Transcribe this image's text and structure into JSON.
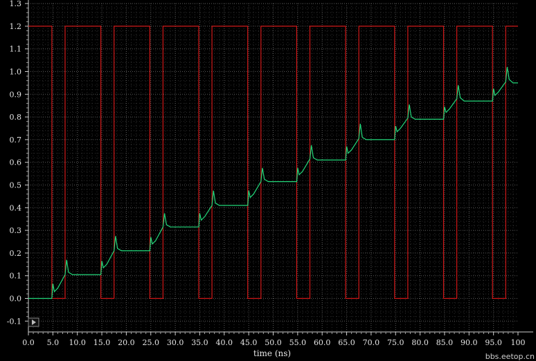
{
  "chart_data": {
    "type": "line",
    "title": "",
    "xlabel": "time (ns)",
    "ylabel": "",
    "xlim": [
      0,
      100
    ],
    "ylim": [
      -0.1,
      1.3
    ],
    "xticks": [
      "0.0",
      "5.0",
      "10.0",
      "15.0",
      "20.0",
      "25.0",
      "30.0",
      "35.0",
      "40.0",
      "45.0",
      "50.0",
      "55.0",
      "60.0",
      "65.0",
      "70.0",
      "75.0",
      "80.0",
      "85.0",
      "90.0",
      "95.0",
      "100"
    ],
    "yticks": [
      "-0.1",
      "0.0",
      "0.1",
      "0.2",
      "0.3",
      "0.4",
      "0.5",
      "0.6",
      "0.7",
      "0.8",
      "0.9",
      "1.0",
      "1.1",
      "1.2",
      "1.3"
    ],
    "grid": true,
    "legend": "none",
    "series": [
      {
        "color": "#d01818",
        "x": [
          0,
          4.8,
          4.8,
          7.5,
          7.5,
          14.8,
          14.8,
          17.5,
          17.5,
          24.8,
          24.8,
          27.5,
          27.5,
          34.8,
          34.8,
          37.5,
          37.5,
          44.8,
          44.8,
          47.5,
          47.5,
          54.8,
          54.8,
          57.5,
          57.5,
          64.8,
          64.8,
          67.5,
          67.5,
          74.8,
          74.8,
          77.5,
          77.5,
          84.8,
          84.8,
          87.5,
          87.5,
          94.8,
          94.8,
          97.5,
          97.5,
          100
        ],
        "values": [
          1.2,
          1.2,
          0,
          0,
          1.2,
          1.2,
          0,
          0,
          1.2,
          1.2,
          0,
          0,
          1.2,
          1.2,
          0,
          0,
          1.2,
          1.2,
          0,
          0,
          1.2,
          1.2,
          0,
          0,
          1.2,
          1.2,
          0,
          0,
          1.2,
          1.2,
          0,
          0,
          1.2,
          1.2,
          0,
          0,
          1.2,
          1.2,
          0,
          0,
          1.2,
          1.2
        ]
      },
      {
        "color": "#22d87a",
        "x": [
          0,
          4.8,
          5.0,
          5.3,
          6.0,
          7.5,
          7.8,
          8.2,
          9.0,
          14.8,
          15.0,
          15.3,
          16.0,
          17.5,
          17.8,
          18.2,
          19.0,
          24.8,
          25.0,
          25.3,
          26.0,
          27.5,
          27.8,
          28.2,
          29.0,
          34.8,
          35.0,
          35.3,
          36.0,
          37.5,
          37.8,
          38.2,
          39.0,
          44.8,
          45.0,
          45.3,
          46.0,
          47.5,
          47.8,
          48.2,
          49.0,
          54.8,
          55.0,
          55.3,
          56.0,
          57.5,
          57.8,
          58.2,
          59.0,
          64.8,
          65.0,
          65.3,
          66.0,
          67.5,
          67.8,
          68.2,
          69.0,
          74.8,
          75.0,
          75.3,
          76.0,
          77.5,
          77.8,
          78.2,
          79.0,
          84.8,
          85.0,
          85.3,
          86.0,
          87.5,
          87.8,
          88.2,
          89.0,
          94.8,
          95.0,
          95.3,
          96.0,
          97.5,
          97.8,
          98.2,
          99.0,
          100
        ],
        "values": [
          0.0,
          0.0,
          0.065,
          0.03,
          0.045,
          0.105,
          0.17,
          0.115,
          0.105,
          0.105,
          0.165,
          0.135,
          0.15,
          0.21,
          0.275,
          0.22,
          0.21,
          0.21,
          0.27,
          0.24,
          0.255,
          0.315,
          0.375,
          0.325,
          0.315,
          0.315,
          0.375,
          0.345,
          0.36,
          0.41,
          0.475,
          0.42,
          0.41,
          0.41,
          0.475,
          0.445,
          0.46,
          0.515,
          0.575,
          0.525,
          0.515,
          0.515,
          0.575,
          0.545,
          0.56,
          0.615,
          0.675,
          0.62,
          0.61,
          0.61,
          0.67,
          0.64,
          0.655,
          0.705,
          0.77,
          0.71,
          0.7,
          0.7,
          0.76,
          0.735,
          0.75,
          0.795,
          0.855,
          0.8,
          0.79,
          0.79,
          0.845,
          0.82,
          0.835,
          0.88,
          0.94,
          0.885,
          0.87,
          0.87,
          0.925,
          0.895,
          0.91,
          0.955,
          1.02,
          0.965,
          0.95,
          0.95
        ]
      }
    ]
  },
  "watermark": "bbs.eetop.cn"
}
